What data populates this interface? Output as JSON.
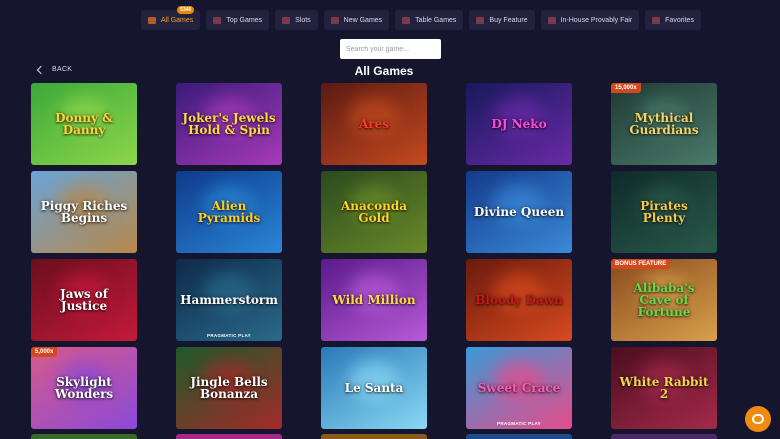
{
  "nav": {
    "items": [
      {
        "label": "All Games",
        "icon": "grid-icon",
        "badge": "5346",
        "active": true
      },
      {
        "label": "Top Games",
        "icon": "top-games-icon"
      },
      {
        "label": "Slots",
        "icon": "slots-icon"
      },
      {
        "label": "New Games",
        "icon": "new-games-icon"
      },
      {
        "label": "Table Games",
        "icon": "table-games-icon"
      },
      {
        "label": "Buy Feature",
        "icon": "buy-feature-icon"
      },
      {
        "label": "In-House Provably Fair",
        "icon": "provably-fair-icon"
      },
      {
        "label": "Favorites",
        "icon": "favorites-icon"
      }
    ]
  },
  "search": {
    "placeholder": "Search your game..."
  },
  "back": {
    "label": "BACK"
  },
  "title": "All Games",
  "games": [
    {
      "title": "Donny & Danny",
      "tag": "",
      "provider": "",
      "colors": [
        "#3aa93a",
        "#8ed64a"
      ],
      "text": "#ffd23a"
    },
    {
      "title": "Joker's Jewels Hold & Spin",
      "tag": "",
      "provider": "",
      "colors": [
        "#3b1b7a",
        "#a63ab8"
      ],
      "text": "#ffd84a"
    },
    {
      "title": "Ares",
      "tag": "",
      "provider": "",
      "colors": [
        "#5a1a14",
        "#c44a1e"
      ],
      "text": "#ff3a2a"
    },
    {
      "title": "DJ Neko",
      "tag": "",
      "provider": "",
      "colors": [
        "#161a5a",
        "#6a2aa8"
      ],
      "text": "#ff4ad8"
    },
    {
      "title": "Mythical Guardians",
      "tag": "15,000x",
      "provider": "",
      "colors": [
        "#1f3a34",
        "#4a7a6a"
      ],
      "text": "#f6d36a"
    },
    {
      "title": "Piggy Riches Begins",
      "tag": "",
      "provider": "",
      "colors": [
        "#6aa4d8",
        "#b8884a"
      ],
      "text": "#ffffff"
    },
    {
      "title": "Alien Pyramids",
      "tag": "",
      "provider": "",
      "colors": [
        "#0e3a8a",
        "#2a86d8"
      ],
      "text": "#ffcc22"
    },
    {
      "title": "Anaconda Gold",
      "tag": "",
      "provider": "",
      "colors": [
        "#2a4a1e",
        "#6a8a2a"
      ],
      "text": "#ffd22a"
    },
    {
      "title": "Divine Queen",
      "tag": "",
      "provider": "",
      "colors": [
        "#143a8a",
        "#3a8ad8"
      ],
      "text": "#ffffff"
    },
    {
      "title": "Pirates Plenty",
      "tag": "",
      "provider": "",
      "colors": [
        "#0e2a2a",
        "#2a5a4a"
      ],
      "text": "#f4c84a"
    },
    {
      "title": "Jaws of Justice",
      "tag": "",
      "provider": "",
      "colors": [
        "#6a0e1e",
        "#c41a3a"
      ],
      "text": "#ffffff"
    },
    {
      "title": "Hammerstorm",
      "tag": "",
      "provider": "PRAGMATIC PLAY",
      "colors": [
        "#0e2a4a",
        "#2a6a8a"
      ],
      "text": "#ffffff"
    },
    {
      "title": "Wild Million",
      "tag": "",
      "provider": "",
      "colors": [
        "#5a1a8a",
        "#b85ad8"
      ],
      "text": "#ffd84a"
    },
    {
      "title": "Bloody Dawn",
      "tag": "",
      "provider": "",
      "colors": [
        "#6a1a0e",
        "#d84a1e"
      ],
      "text": "#c41a1a"
    },
    {
      "title": "Alibaba's Cave of Fortune",
      "tag": "BONUS FEATURE",
      "provider": "",
      "colors": [
        "#8a4a1e",
        "#d8a04a"
      ],
      "text": "#6ad84a"
    },
    {
      "title": "Skylight Wonders",
      "tag": "5,000x",
      "provider": "",
      "colors": [
        "#d85a8a",
        "#8a4ad8"
      ],
      "text": "#ffffff"
    },
    {
      "title": "Jingle Bells Bonanza",
      "tag": "",
      "provider": "",
      "colors": [
        "#1e5a2a",
        "#a42a2a"
      ],
      "text": "#ffffff"
    },
    {
      "title": "Le Santa",
      "tag": "",
      "provider": "",
      "colors": [
        "#2a7ab8",
        "#8ad8f4"
      ],
      "text": "#ffffff"
    },
    {
      "title": "Sweet Crace",
      "tag": "",
      "provider": "PRAGMATIC PLAY",
      "colors": [
        "#3a9ad8",
        "#e84a8a"
      ],
      "text": "#ff5ab8"
    },
    {
      "title": "White Rabbit 2",
      "tag": "",
      "provider": "",
      "colors": [
        "#4a0e1e",
        "#a42a4a"
      ],
      "text": "#f4d84a"
    }
  ],
  "row5_colors": [
    "#3a6a2a",
    "#a42a8a",
    "#8a5a1e",
    "#1e4a8a",
    "#4a2a6a"
  ]
}
